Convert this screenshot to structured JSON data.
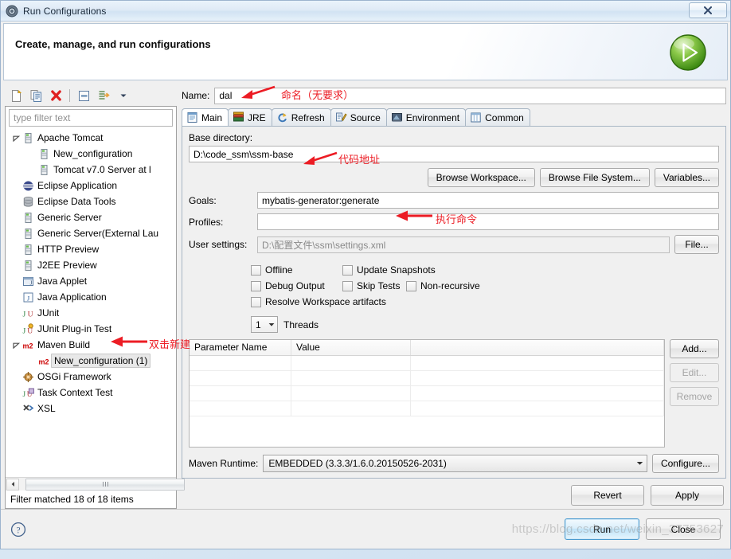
{
  "window": {
    "title": "Run Configurations",
    "title_icon": "run-config-icon",
    "close_label": "x"
  },
  "banner": {
    "title": "Create, manage, and run configurations",
    "icon": "green-play-icon"
  },
  "tree_toolbar": {
    "buttons": [
      {
        "name": "new-configuration-button",
        "icon": "new-document-icon",
        "tooltip": "New launch configuration"
      },
      {
        "name": "duplicate-button",
        "icon": "copy-icon",
        "tooltip": "Duplicate"
      },
      {
        "name": "delete-button",
        "icon": "red-x-icon",
        "tooltip": "Delete"
      },
      {
        "name": "collapse-all-button",
        "icon": "collapse-all-icon",
        "tooltip": "Collapse All"
      },
      {
        "name": "filter-button",
        "icon": "filter-arrow-icon",
        "tooltip": "Filter"
      },
      {
        "name": "menu-dropdown-button",
        "icon": "chevron-down-icon",
        "tooltip": "View Menu"
      }
    ]
  },
  "filter": {
    "placeholder": "type filter text",
    "value": "",
    "status": "Filter matched 18 of 18 items"
  },
  "tree": {
    "items": [
      {
        "label": "Apache Tomcat",
        "icon": "server-icon",
        "indent": 0,
        "twisty": "expanded",
        "selected": false
      },
      {
        "label": "New_configuration",
        "icon": "server-icon",
        "indent": 1,
        "twisty": "none",
        "selected": false
      },
      {
        "label": "Tomcat v7.0 Server at l",
        "icon": "server-icon",
        "indent": 1,
        "twisty": "none",
        "selected": false
      },
      {
        "label": "Eclipse Application",
        "icon": "eclipse-icon",
        "indent": 0,
        "twisty": "none",
        "selected": false
      },
      {
        "label": "Eclipse Data Tools",
        "icon": "database-icon",
        "indent": 0,
        "twisty": "none",
        "selected": false
      },
      {
        "label": "Generic Server",
        "icon": "server-icon",
        "indent": 0,
        "twisty": "none",
        "selected": false
      },
      {
        "label": "Generic Server(External Lau",
        "icon": "server-icon",
        "indent": 0,
        "twisty": "none",
        "selected": false
      },
      {
        "label": "HTTP Preview",
        "icon": "server-icon",
        "indent": 0,
        "twisty": "none",
        "selected": false
      },
      {
        "label": "J2EE Preview",
        "icon": "server-icon",
        "indent": 0,
        "twisty": "none",
        "selected": false
      },
      {
        "label": "Java Applet",
        "icon": "java-applet-icon",
        "indent": 0,
        "twisty": "none",
        "selected": false
      },
      {
        "label": "Java Application",
        "icon": "java-application-icon",
        "indent": 0,
        "twisty": "none",
        "selected": false
      },
      {
        "label": "JUnit",
        "icon": "junit-icon",
        "indent": 0,
        "twisty": "none",
        "selected": false
      },
      {
        "label": "JUnit Plug-in Test",
        "icon": "junit-plugin-icon",
        "indent": 0,
        "twisty": "none",
        "selected": false
      },
      {
        "label": "Maven Build",
        "icon": "m2-icon",
        "indent": 0,
        "twisty": "expanded",
        "selected": false
      },
      {
        "label": "New_configuration (1)",
        "icon": "m2-icon",
        "indent": 1,
        "twisty": "none",
        "selected": true
      },
      {
        "label": "OSGi Framework",
        "icon": "osgi-icon",
        "indent": 0,
        "twisty": "none",
        "selected": false
      },
      {
        "label": "Task Context Test",
        "icon": "task-context-icon",
        "indent": 0,
        "twisty": "none",
        "selected": false
      },
      {
        "label": "XSL",
        "icon": "xsl-icon",
        "indent": 0,
        "twisty": "none",
        "selected": false
      }
    ]
  },
  "name_field": {
    "label": "Name:",
    "value": "dal",
    "placeholder": ""
  },
  "tabs": [
    {
      "label": "Main",
      "icon": "main-tab-icon",
      "active": true
    },
    {
      "label": "JRE",
      "icon": "jre-tab-icon",
      "active": false
    },
    {
      "label": "Refresh",
      "icon": "refresh-tab-icon",
      "active": false
    },
    {
      "label": "Source",
      "icon": "source-tab-icon",
      "active": false
    },
    {
      "label": "Environment",
      "icon": "environment-tab-icon",
      "active": false
    },
    {
      "label": "Common",
      "icon": "common-tab-icon",
      "active": false
    }
  ],
  "main_tab": {
    "base_directory_label": "Base directory:",
    "base_directory_value": "D:\\code_ssm\\ssm-base",
    "browse_workspace": "Browse Workspace...",
    "browse_file_system": "Browse File System...",
    "variables": "Variables...",
    "goals_label": "Goals:",
    "goals_value": "mybatis-generator:generate",
    "profiles_label": "Profiles:",
    "profiles_value": "",
    "user_settings_label": "User settings:",
    "user_settings_value": "D:\\配置文件\\ssm\\settings.xml",
    "file_button": "File...",
    "checkboxes": [
      {
        "label": "Offline",
        "checked": false
      },
      {
        "label": "Update Snapshots",
        "checked": false
      },
      {
        "label": "Debug Output",
        "checked": false
      },
      {
        "label": "Skip Tests",
        "checked": false
      },
      {
        "label": "Non-recursive",
        "checked": false
      },
      {
        "label": "Resolve Workspace artifacts",
        "checked": false
      }
    ],
    "threads_value": "1",
    "threads_label": "Threads",
    "param_columns": [
      "Parameter Name",
      "Value"
    ],
    "param_rows": [],
    "add_button": "Add...",
    "edit_button": "Edit...",
    "remove_button": "Remove",
    "maven_runtime_label": "Maven Runtime:",
    "maven_runtime_value": "EMBEDDED (3.3.3/1.6.0.20150526-2031)",
    "configure_button": "Configure..."
  },
  "action_buttons": {
    "revert": "Revert",
    "apply": "Apply",
    "run": "Run",
    "close": "Close",
    "help_icon": "help-question-icon"
  },
  "annotations": [
    {
      "text": "命名（无要求）",
      "name": "annotation-name-field"
    },
    {
      "text": "代码地址",
      "name": "annotation-base-directory"
    },
    {
      "text": "执行命令",
      "name": "annotation-goals"
    },
    {
      "text": "双击新建",
      "name": "annotation-maven-build"
    }
  ],
  "watermark": "https://blog.csdn.net/weixin_37753627",
  "colors": {
    "annotation_red": "#ec1c24",
    "accent_blue": "#4a9bd0",
    "m2_red": "#cc0000",
    "play_green": "#4caf1f"
  }
}
